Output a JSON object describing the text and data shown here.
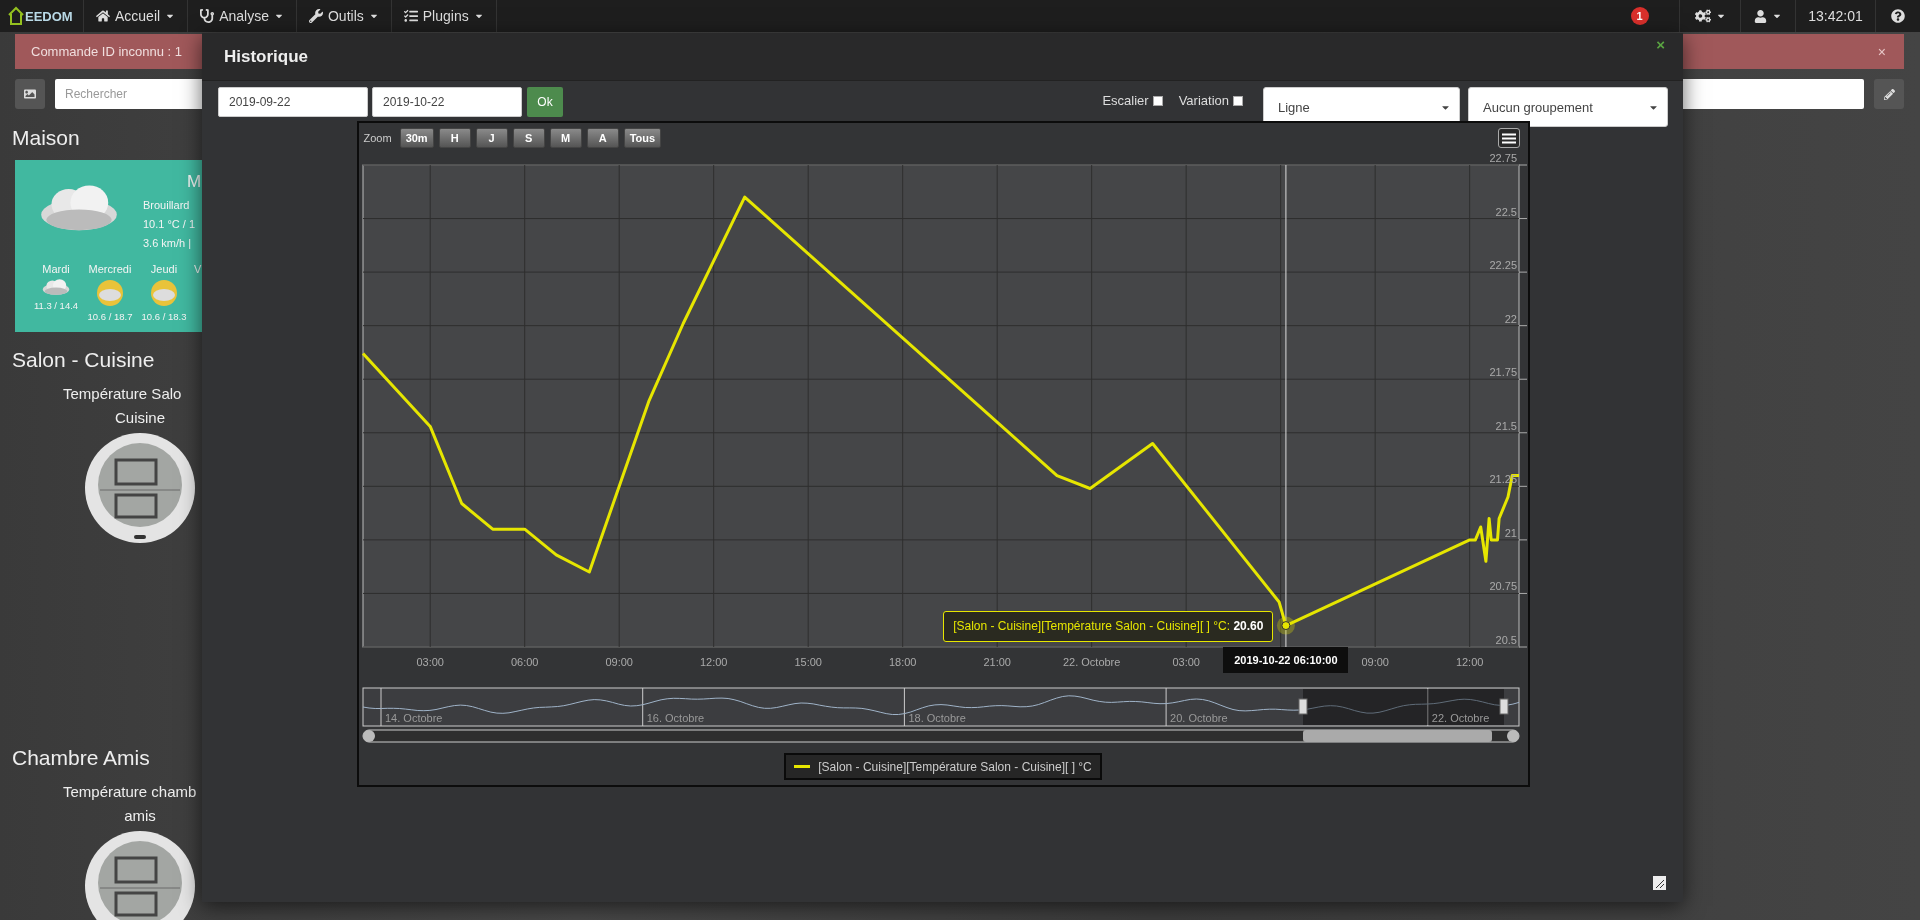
{
  "navbar": {
    "logo": "EEDOM",
    "menus": [
      "Accueil",
      "Analyse",
      "Outils",
      "Plugins"
    ],
    "notifications": "1",
    "time": "13:42:01"
  },
  "alert": {
    "message": "Commande ID inconnu : 1",
    "close": "×"
  },
  "search": {
    "placeholder": "Rechercher"
  },
  "objects": [
    {
      "title": "Maison",
      "kind": "weather",
      "weather": {
        "city": "M",
        "condition": "Brouillard",
        "temperature": "10.1 °C / 1",
        "wind": "3.6 km/h |",
        "forecast": [
          {
            "day": "Mardi",
            "temps": "11.3 / 14.4",
            "kind": "cloud"
          },
          {
            "day": "Mercredi",
            "temps": "10.6 / 18.7",
            "kind": "sun"
          },
          {
            "day": "Jeudi",
            "temps": "10.6 / 18.3",
            "kind": "sun"
          },
          {
            "day": "V",
            "kind": "none"
          }
        ]
      }
    },
    {
      "title": "Salon - Cuisine",
      "kind": "sensor",
      "name_lines": [
        "Température Salo",
        "Cuisine"
      ]
    },
    {
      "title": "Chambre Amis",
      "kind": "sensor",
      "name_lines": [
        "Température chamb",
        "amis"
      ]
    }
  ],
  "modal": {
    "title": "Historique",
    "close": "×",
    "start_date": "2019-09-22",
    "end_date": "2019-10-22",
    "ok": "Ok",
    "options": [
      {
        "label": "Escalier",
        "checked": false
      },
      {
        "label": "Variation",
        "checked": false
      }
    ],
    "selects": [
      "Ligne",
      "Aucun groupement"
    ],
    "chart": {
      "zoom_label": "Zoom",
      "zoom_buttons": [
        "30m",
        "H",
        "J",
        "S",
        "M",
        "A",
        "Tous"
      ],
      "chart_data": {
        "type": "line",
        "grid": true,
        "x": [
          "2019-10-21T00:52:00Z",
          "2019-10-21T03:00:00Z",
          "2019-10-21T04:00:00Z",
          "2019-10-21T04:59:00Z",
          "2019-10-21T06:00:00Z",
          "2019-10-21T07:00:00Z",
          "2019-10-21T08:03:00Z",
          "2019-10-21T09:57:00Z",
          "2019-10-21T11:02:00Z",
          "2019-10-21T12:59:00Z",
          "2019-10-21T22:54:00Z",
          "2019-10-21T23:57:00Z",
          "2019-10-22T01:56:00Z",
          "2019-10-22T05:57:00Z",
          "2019-10-22T06:10:00Z",
          "2019-10-22T12:00:00Z",
          "2019-10-22T12:11:00Z",
          "2019-10-22T12:21:00Z",
          "2019-10-22T12:31:00Z",
          "2019-10-22T12:37:00Z",
          "2019-10-22T12:41:00Z",
          "2019-10-22T12:53:00Z",
          "2019-10-22T12:56:00Z",
          "2019-10-22T13:13:00Z",
          "2019-10-22T13:21:00Z",
          "2019-10-22T13:34:00Z"
        ],
        "series": [
          {
            "name": "[Salon - Cuisine][Température Salon - Cuisine][ ] °C",
            "color": "#e6e600",
            "values": [
              21.87,
              21.53,
              21.17,
              21.05,
              21.05,
              20.93,
              20.85,
              21.65,
              22.01,
              22.6,
              21.3,
              21.24,
              21.45,
              20.71,
              20.6,
              21.0,
              21.0,
              21.06,
              20.9,
              21.1,
              21.0,
              21.0,
              21.1,
              21.2,
              21.3,
              21.3
            ]
          }
        ],
        "xlim": [
          "2019-10-21T00:52:00Z",
          "2019-10-22T13:34:00Z"
        ],
        "ylim": [
          20.5,
          22.75
        ],
        "xticks": [
          {
            "value": "2019-10-21T03:00:00Z",
            "label": "03:00"
          },
          {
            "value": "2019-10-21T06:00:00Z",
            "label": "06:00"
          },
          {
            "value": "2019-10-21T09:00:00Z",
            "label": "09:00"
          },
          {
            "value": "2019-10-21T12:00:00Z",
            "label": "12:00"
          },
          {
            "value": "2019-10-21T15:00:00Z",
            "label": "15:00"
          },
          {
            "value": "2019-10-21T18:00:00Z",
            "label": "18:00"
          },
          {
            "value": "2019-10-21T21:00:00Z",
            "label": "21:00"
          },
          {
            "value": "2019-10-22T00:00:00Z",
            "label": "22. Octobre"
          },
          {
            "value": "2019-10-22T03:00:00Z",
            "label": "03:00"
          },
          {
            "value": "2019-10-22T09:00:00Z",
            "label": "09:00"
          },
          {
            "value": "2019-10-22T12:00:00Z",
            "label": "12:00"
          }
        ],
        "yticks": [
          20.5,
          20.75,
          21,
          21.25,
          21.5,
          21.75,
          22,
          22.25,
          22.5,
          22.75
        ],
        "ref_lines": [
          {
            "axis": "x",
            "value": "2019-10-22T06:10:00Z",
            "label": "2019-10-22 06:10:00"
          }
        ],
        "annotations": [
          {
            "x": "2019-10-22T06:10:00Z",
            "y": 20.6,
            "text": "[Salon - Cuisine][Température Salon - Cuisine][ ] °C: **20.60**"
          }
        ]
      },
      "navigator": {
        "labels": [
          "14. Octobre",
          "16. Octobre",
          "18. Octobre",
          "20. Octobre",
          "22. Octobre"
        ]
      }
    }
  }
}
